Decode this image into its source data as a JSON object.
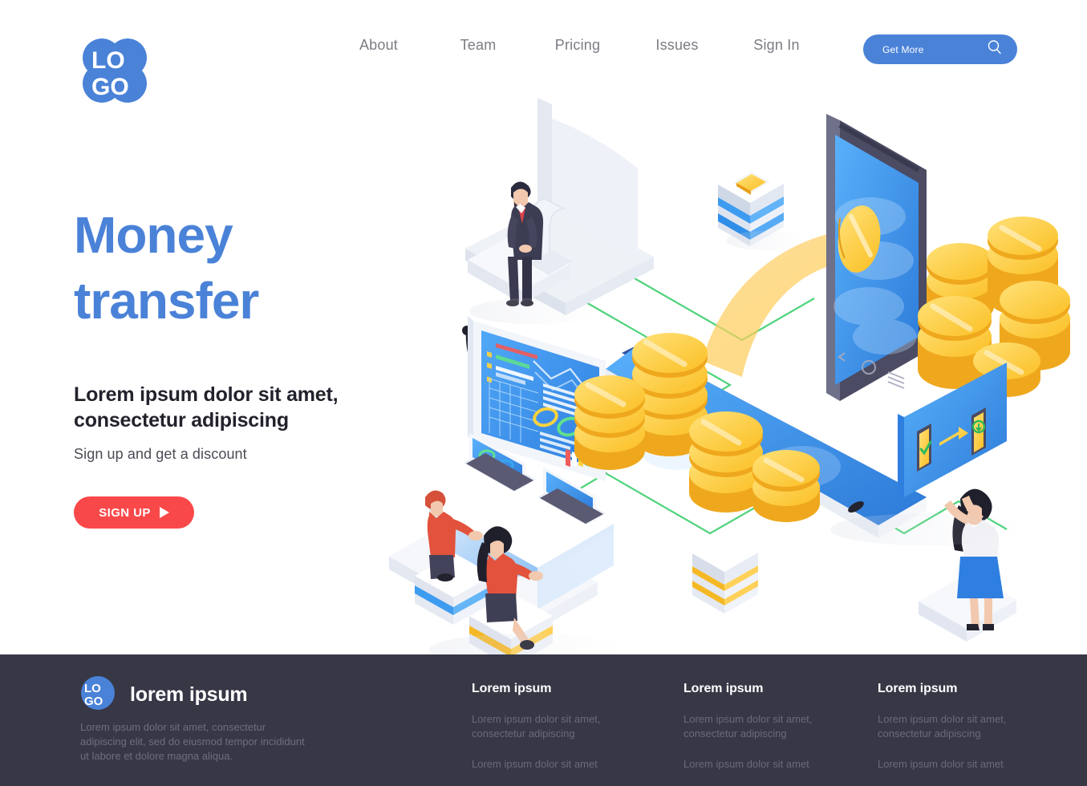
{
  "header": {
    "logo": {
      "name": "LOGO",
      "line1": "LO",
      "line2": "GO"
    },
    "nav": [
      {
        "label": "About"
      },
      {
        "label": "Team"
      },
      {
        "label": "Pricing"
      },
      {
        "label": "Issues"
      },
      {
        "label": "Sign In"
      }
    ],
    "cta": {
      "label": "Get More",
      "icon": "search-icon"
    }
  },
  "hero": {
    "title_line1": "Money",
    "title_line2": "transfer",
    "subtitle_line1": "Lorem ipsum dolor sit amet,",
    "subtitle_line2": "consectetur adipiscing",
    "tagline": "Sign up and get a discount",
    "cta_label": "SIGN UP",
    "cta_icon": "play-triangle-icon"
  },
  "illustration": {
    "name": "isometric-money-transfer-illustration",
    "elements": [
      "desktop-monitor-back",
      "businessman-in-suit",
      "server-box-blue-with-gold-coin-slot",
      "dashboard-tablet-screen",
      "smartphone-blue-screen",
      "gold-coin-stacks",
      "large-tablet-with-coins",
      "two-coworkers-with-laptops",
      "woman-at-payment-screen",
      "payment-transfer-screen",
      "stacked-box-gold",
      "green-connector-lines",
      "black-cable"
    ]
  },
  "footer": {
    "logo": {
      "name": "LOGO",
      "line1": "LO",
      "line2": "GO"
    },
    "brand_title": "lorem ipsum",
    "about": "Lorem ipsum dolor sit amet, consectetur adipiscing elit, sed do eiusmod tempor incididunt ut labore et dolore magna aliqua.",
    "columns": [
      {
        "title": "Lorem ipsum",
        "links": [
          "Lorem ipsum dolor sit amet, consectetur adipiscing",
          "Lorem ipsum dolor sit amet"
        ]
      },
      {
        "title": "Lorem ipsum",
        "links": [
          "Lorem ipsum dolor sit amet, consectetur adipiscing",
          "Lorem ipsum dolor sit amet"
        ]
      },
      {
        "title": "Lorem ipsum",
        "links": [
          "Lorem ipsum dolor sit amet, consectetur adipiscing",
          "Lorem ipsum dolor sit amet"
        ]
      }
    ]
  },
  "colors": {
    "brand_blue": "#4a82d8",
    "accent_red": "#f9484a",
    "footer_bg": "#373746",
    "nav_text": "#7b7b84",
    "heading_dark": "#22222c",
    "gold": "#fbbf24",
    "green_line": "#4ed37b"
  }
}
